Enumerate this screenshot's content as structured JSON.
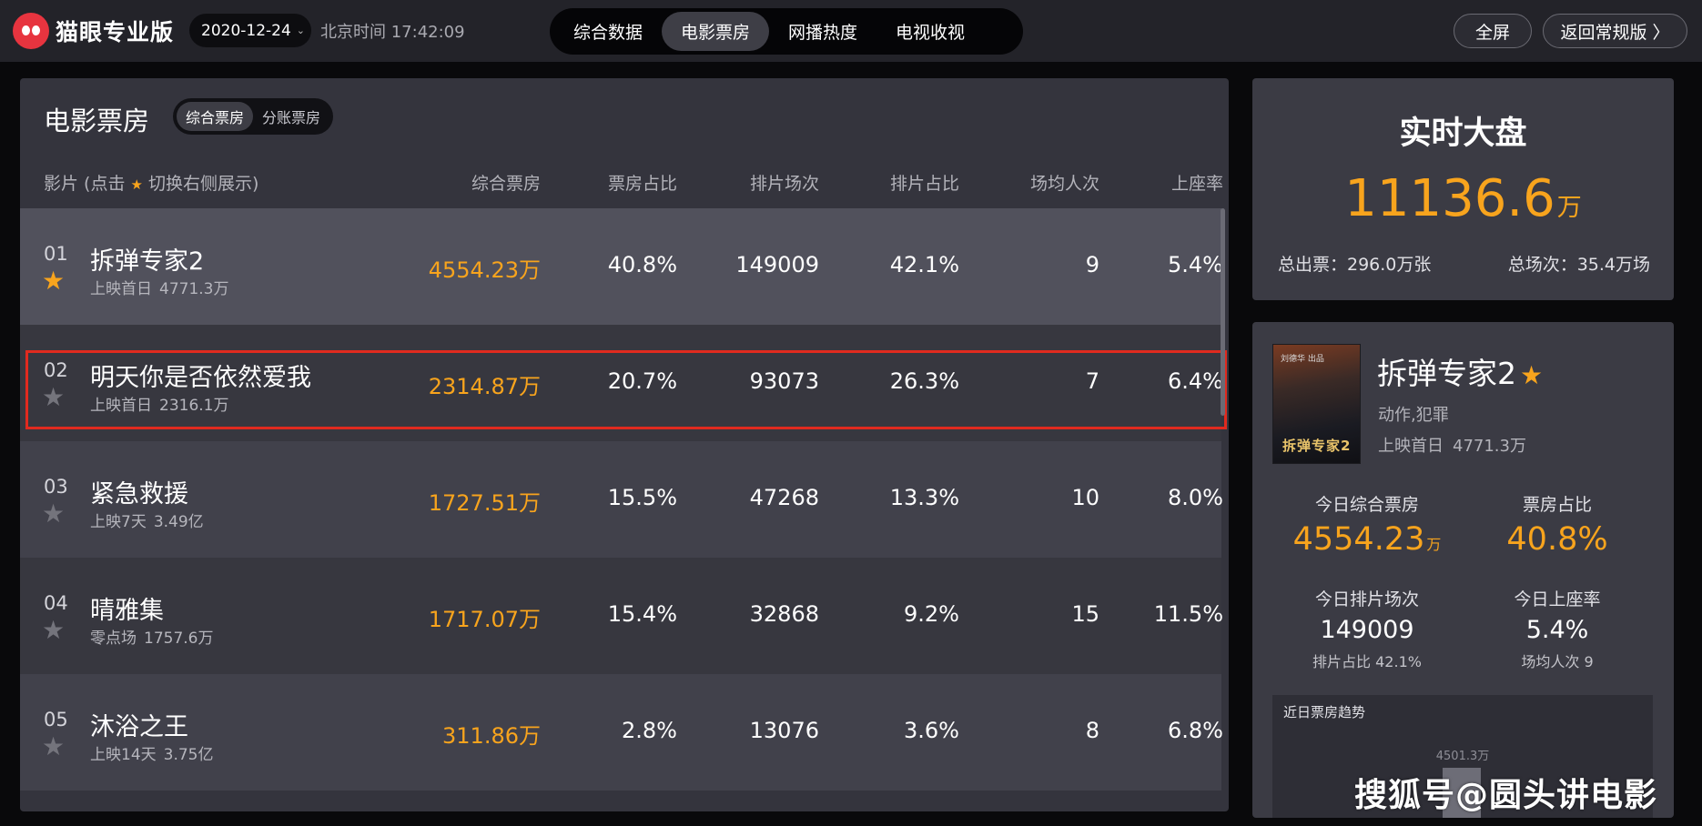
{
  "topbar": {
    "logo_text": "猫眼专业版",
    "date": "2020-12-24",
    "date_chevron": "⌄",
    "clock": "北京时间 17:42:09",
    "tabs": [
      {
        "label": "综合数据",
        "active": false
      },
      {
        "label": "电影票房",
        "active": true
      },
      {
        "label": "网播热度",
        "active": false
      },
      {
        "label": "电视收视",
        "active": false
      }
    ],
    "fullscreen_label": "全屏",
    "back_label": "返回常规版 〉"
  },
  "box_office": {
    "title": "电影票房",
    "switch": [
      "综合票房",
      "分账票房"
    ],
    "columns": {
      "film_prefix": "影片 (点击 ",
      "film_suffix": " 切换右侧展示)",
      "box": "综合票房",
      "box_pct": "票房占比",
      "shows": "排片场次",
      "show_pct": "排片占比",
      "avg": "场均人次",
      "seat": "上座率"
    },
    "rows": [
      {
        "rank": "01",
        "name": "拆弹专家2",
        "release": "上映首日",
        "total": "4771.3万",
        "box": "4554.23万",
        "box_pct": "40.8%",
        "shows": "149009",
        "show_pct": "42.1%",
        "avg": "9",
        "seat": "5.4%",
        "starred": true
      },
      {
        "rank": "02",
        "name": "明天你是否依然爱我",
        "release": "上映首日",
        "total": "2316.1万",
        "box": "2314.87万",
        "box_pct": "20.7%",
        "shows": "93073",
        "show_pct": "26.3%",
        "avg": "7",
        "seat": "6.4%",
        "starred": false
      },
      {
        "rank": "03",
        "name": "紧急救援",
        "release": "上映7天",
        "total": "3.49亿",
        "box": "1727.51万",
        "box_pct": "15.5%",
        "shows": "47268",
        "show_pct": "13.3%",
        "avg": "10",
        "seat": "8.0%",
        "starred": false
      },
      {
        "rank": "04",
        "name": "晴雅集",
        "release": "零点场",
        "total": "1757.6万",
        "box": "1717.07万",
        "box_pct": "15.4%",
        "shows": "32868",
        "show_pct": "9.2%",
        "avg": "15",
        "seat": "11.5%",
        "starred": false
      },
      {
        "rank": "05",
        "name": "沐浴之王",
        "release": "上映14天",
        "total": "3.75亿",
        "box": "311.86万",
        "box_pct": "2.8%",
        "shows": "13076",
        "show_pct": "3.6%",
        "avg": "8",
        "seat": "6.8%",
        "starred": false
      }
    ]
  },
  "realtime": {
    "title": "实时大盘",
    "value": "11136.6",
    "unit": "万",
    "total_tickets": "总出票：296.0万张",
    "total_shows": "总场次：35.4万场"
  },
  "detail": {
    "poster_top": "刘德华 出品",
    "poster_title": "拆弹专家2",
    "name": "拆弹专家2",
    "genre": "动作,犯罪",
    "release": "上映首日",
    "total": "4771.3万",
    "today_box_label": "今日综合票房",
    "today_box": "4554.23",
    "today_box_unit": "万",
    "box_pct_label": "票房占比",
    "box_pct": "40.8%",
    "shows_label": "今日排片场次",
    "shows": "149009",
    "show_pct_text": "排片占比 42.1%",
    "seat_label": "今日上座率",
    "seat": "5.4%",
    "avg_text": "场均人次 9",
    "trend_title": "近日票房趋势",
    "trend_label": "4501.3万"
  },
  "watermark": "搜狐号@圆头讲电影",
  "colors": {
    "accent": "#f8a41d",
    "highlight": "#e02a1f",
    "panel": "#34343d"
  },
  "icons": {
    "star": "★",
    "chevron": "〉"
  }
}
